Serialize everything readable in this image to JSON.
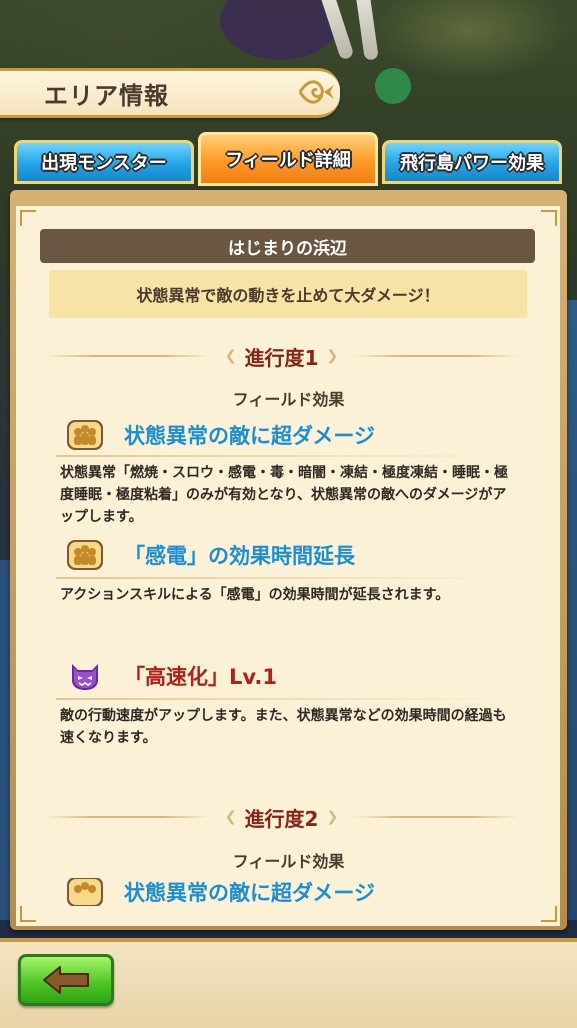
{
  "header": {
    "title": "エリア情報"
  },
  "tabs": [
    {
      "label": "出現モンスター"
    },
    {
      "label": "フィールド詳細"
    },
    {
      "label": "飛行島パワー効果"
    }
  ],
  "area": {
    "name": "はじまりの浜辺",
    "description": "状態異常で敵の動きを止めて大ダメージ！"
  },
  "stages": [
    {
      "label": "進行度1",
      "field_effect_label": "フィールド効果",
      "effects": [
        {
          "icon": "party-icon",
          "name": "状態異常の敵に超ダメージ",
          "description": "状態異常「燃焼・スロウ・感電・毒・暗闇・凍結・極度凍結・睡眠・極度睡眠・極度粘着」のみが有効となり、状態異常の敵へのダメージがアップします。"
        },
        {
          "icon": "party-icon",
          "name": "「感電」の効果時間延長",
          "description": "アクションスキルによる「感電」の効果時間が延長されます。"
        },
        {
          "icon": "demon-icon",
          "name": "「高速化」Lv.1",
          "description": "敵の行動速度がアップします。また、状態異常などの効果時間の経過も速くなります。"
        }
      ]
    },
    {
      "label": "進行度2",
      "field_effect_label": "フィールド効果",
      "effects": [
        {
          "icon": "party-icon",
          "name": "状態異常の敵に超ダメージ"
        }
      ]
    }
  ],
  "colors": {
    "tab_active": "#f17c13",
    "tab_inactive": "#23a4e6",
    "effect_blue": "#1a8fd6",
    "effect_red": "#b31f1a",
    "stage_label": "#8a2418"
  },
  "footer": {
    "back_icon": "back-arrow-icon"
  }
}
